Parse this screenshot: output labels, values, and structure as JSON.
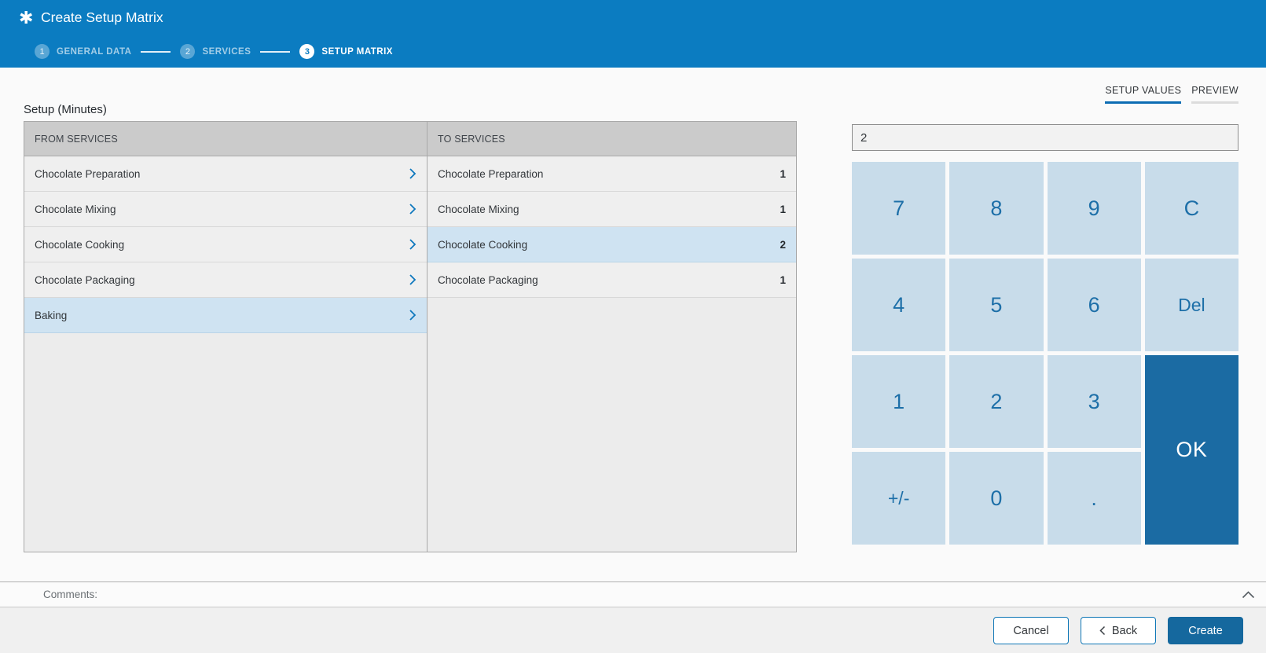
{
  "app": {
    "title": "Create Setup Matrix"
  },
  "wizard_steps": [
    {
      "number": "1",
      "label": "GENERAL DATA",
      "state": "completed"
    },
    {
      "number": "2",
      "label": "SERVICES",
      "state": "completed"
    },
    {
      "number": "3",
      "label": "SETUP MATRIX",
      "state": "active"
    }
  ],
  "tabs": [
    {
      "label": "SETUP VALUES",
      "active": true
    },
    {
      "label": "PREVIEW",
      "active": false
    }
  ],
  "setup_matrix": {
    "section_label": "Setup (Minutes)",
    "from_services": {
      "header": "FROM SERVICES",
      "rows": [
        {
          "label": "Chocolate Preparation",
          "selected": false
        },
        {
          "label": "Chocolate Mixing",
          "selected": false
        },
        {
          "label": "Chocolate Cooking",
          "selected": false
        },
        {
          "label": "Chocolate Packaging",
          "selected": false
        },
        {
          "label": "Baking",
          "selected": true
        }
      ]
    },
    "to_services": {
      "header": "TO SERVICES",
      "rows": [
        {
          "label": "Chocolate Preparation",
          "value": "1",
          "selected": false
        },
        {
          "label": "Chocolate Mixing",
          "value": "1",
          "selected": false
        },
        {
          "label": "Chocolate Cooking",
          "value": "2",
          "selected": true
        },
        {
          "label": "Chocolate Packaging",
          "value": "1",
          "selected": false
        }
      ]
    }
  },
  "value_editor": {
    "input_value": "2",
    "keys": [
      "7",
      "8",
      "9",
      "C",
      "4",
      "5",
      "6",
      "Del",
      "1",
      "2",
      "3",
      "OK",
      "+/-",
      "0",
      "."
    ]
  },
  "comments": {
    "label": "Comments:"
  },
  "footer": {
    "cancel": "Cancel",
    "back": "Back",
    "create": "Create"
  },
  "colors": {
    "header_blue": "#0b7cc1",
    "accent_blue": "#0d77bd",
    "keypad_key_bg": "#c8dcea",
    "keypad_key_text": "#1d6fa8",
    "keypad_ok_bg": "#1b6ba3",
    "primary_button_bg": "#15689e",
    "selected_row_bg": "#cfe3f2",
    "table_header_bg": "#cbcbcb"
  }
}
